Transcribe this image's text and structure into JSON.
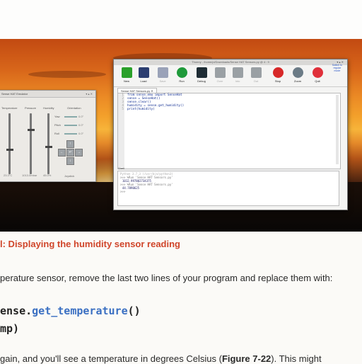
{
  "emulator": {
    "title": "Sense HAT Emulator",
    "columns": [
      "Temperature",
      "Pressure",
      "Humidity",
      "Orientation"
    ],
    "values": [
      "23.3°C",
      "1013.0mbar",
      "45.0%"
    ],
    "orientation": [
      {
        "label": "Yaw",
        "value": "0.0°"
      },
      {
        "label": "Pitch",
        "value": "0.0°"
      },
      {
        "label": "Roll",
        "value": "0.0°"
      }
    ],
    "joystick_label": "Joystick",
    "joystick_arrows": {
      "up": "↑",
      "left": "←",
      "enter": "↵",
      "right": "→",
      "down": "↓"
    }
  },
  "thonny": {
    "title": "Thonny - /home/pi/Downloads/Sense HAT Sensors.py @ 4 : 9",
    "toolbar": [
      {
        "label": "New",
        "icon": "new-icon",
        "color": "#2aa02a",
        "enabled": true
      },
      {
        "label": "Load",
        "icon": "load-icon",
        "color": "#2c3e70",
        "enabled": true
      },
      {
        "label": "Save",
        "icon": "save-icon",
        "color": "#2c3e70",
        "enabled": false
      },
      {
        "label": "Run",
        "icon": "run-icon",
        "color": "#1f9a3a",
        "enabled": true
      },
      {
        "label": "Debug",
        "icon": "debug-icon",
        "color": "#1e2c34",
        "enabled": true
      },
      {
        "label": "Over",
        "icon": "step-over-icon",
        "color": "#2d3a44",
        "enabled": false
      },
      {
        "label": "Into",
        "icon": "step-into-icon",
        "color": "#2d3a44",
        "enabled": false
      },
      {
        "label": "Out",
        "icon": "step-out-icon",
        "color": "#2d3a44",
        "enabled": false
      },
      {
        "label": "Stop",
        "icon": "stop-icon",
        "color": "#d72828",
        "enabled": true
      },
      {
        "label": "Zoom",
        "icon": "zoom-icon",
        "color": "#6b7b86",
        "enabled": true
      },
      {
        "label": "Quit",
        "icon": "quit-icon",
        "color": "#e0303a",
        "enabled": true
      }
    ],
    "switch_mode": [
      "Switch to",
      "regular",
      "mode"
    ],
    "tab": "Sense HAT Sensors.py ✕",
    "line_numbers": [
      "1",
      "2",
      "3",
      "4",
      "5"
    ],
    "code": "from sense_emu import SenseHat\nsense = SenseHat()\nsense.clear()\nhumidity = sense.get_humidity()\nprint(humidity)",
    "shell_label": "Shell",
    "shell": {
      "banner": "Python 3.7.3 (/usr/bin/python3)",
      "run1": ">>> %Run 'Sense HAT Sensors.py'",
      "out1": "1012.997802734375",
      "run2": ">>> %Run 'Sense HAT Sensors.py'",
      "out2": "44.7890625",
      "prompt": ">>>"
    }
  },
  "page": {
    "caption": "l: Displaying the humidity sensor reading",
    "para1": "perature sensor, remove the last two lines of your program and replace them with:",
    "code_line1_prefix": "ense.",
    "code_line1_method": "get_temperature",
    "code_line1_suffix": "()",
    "code_line2": "mp)",
    "para2_start": "gain, and you'll see a temperature in degrees Celsius (",
    "para2_ref": "Figure 7-22",
    "para2_end": "). This might"
  }
}
